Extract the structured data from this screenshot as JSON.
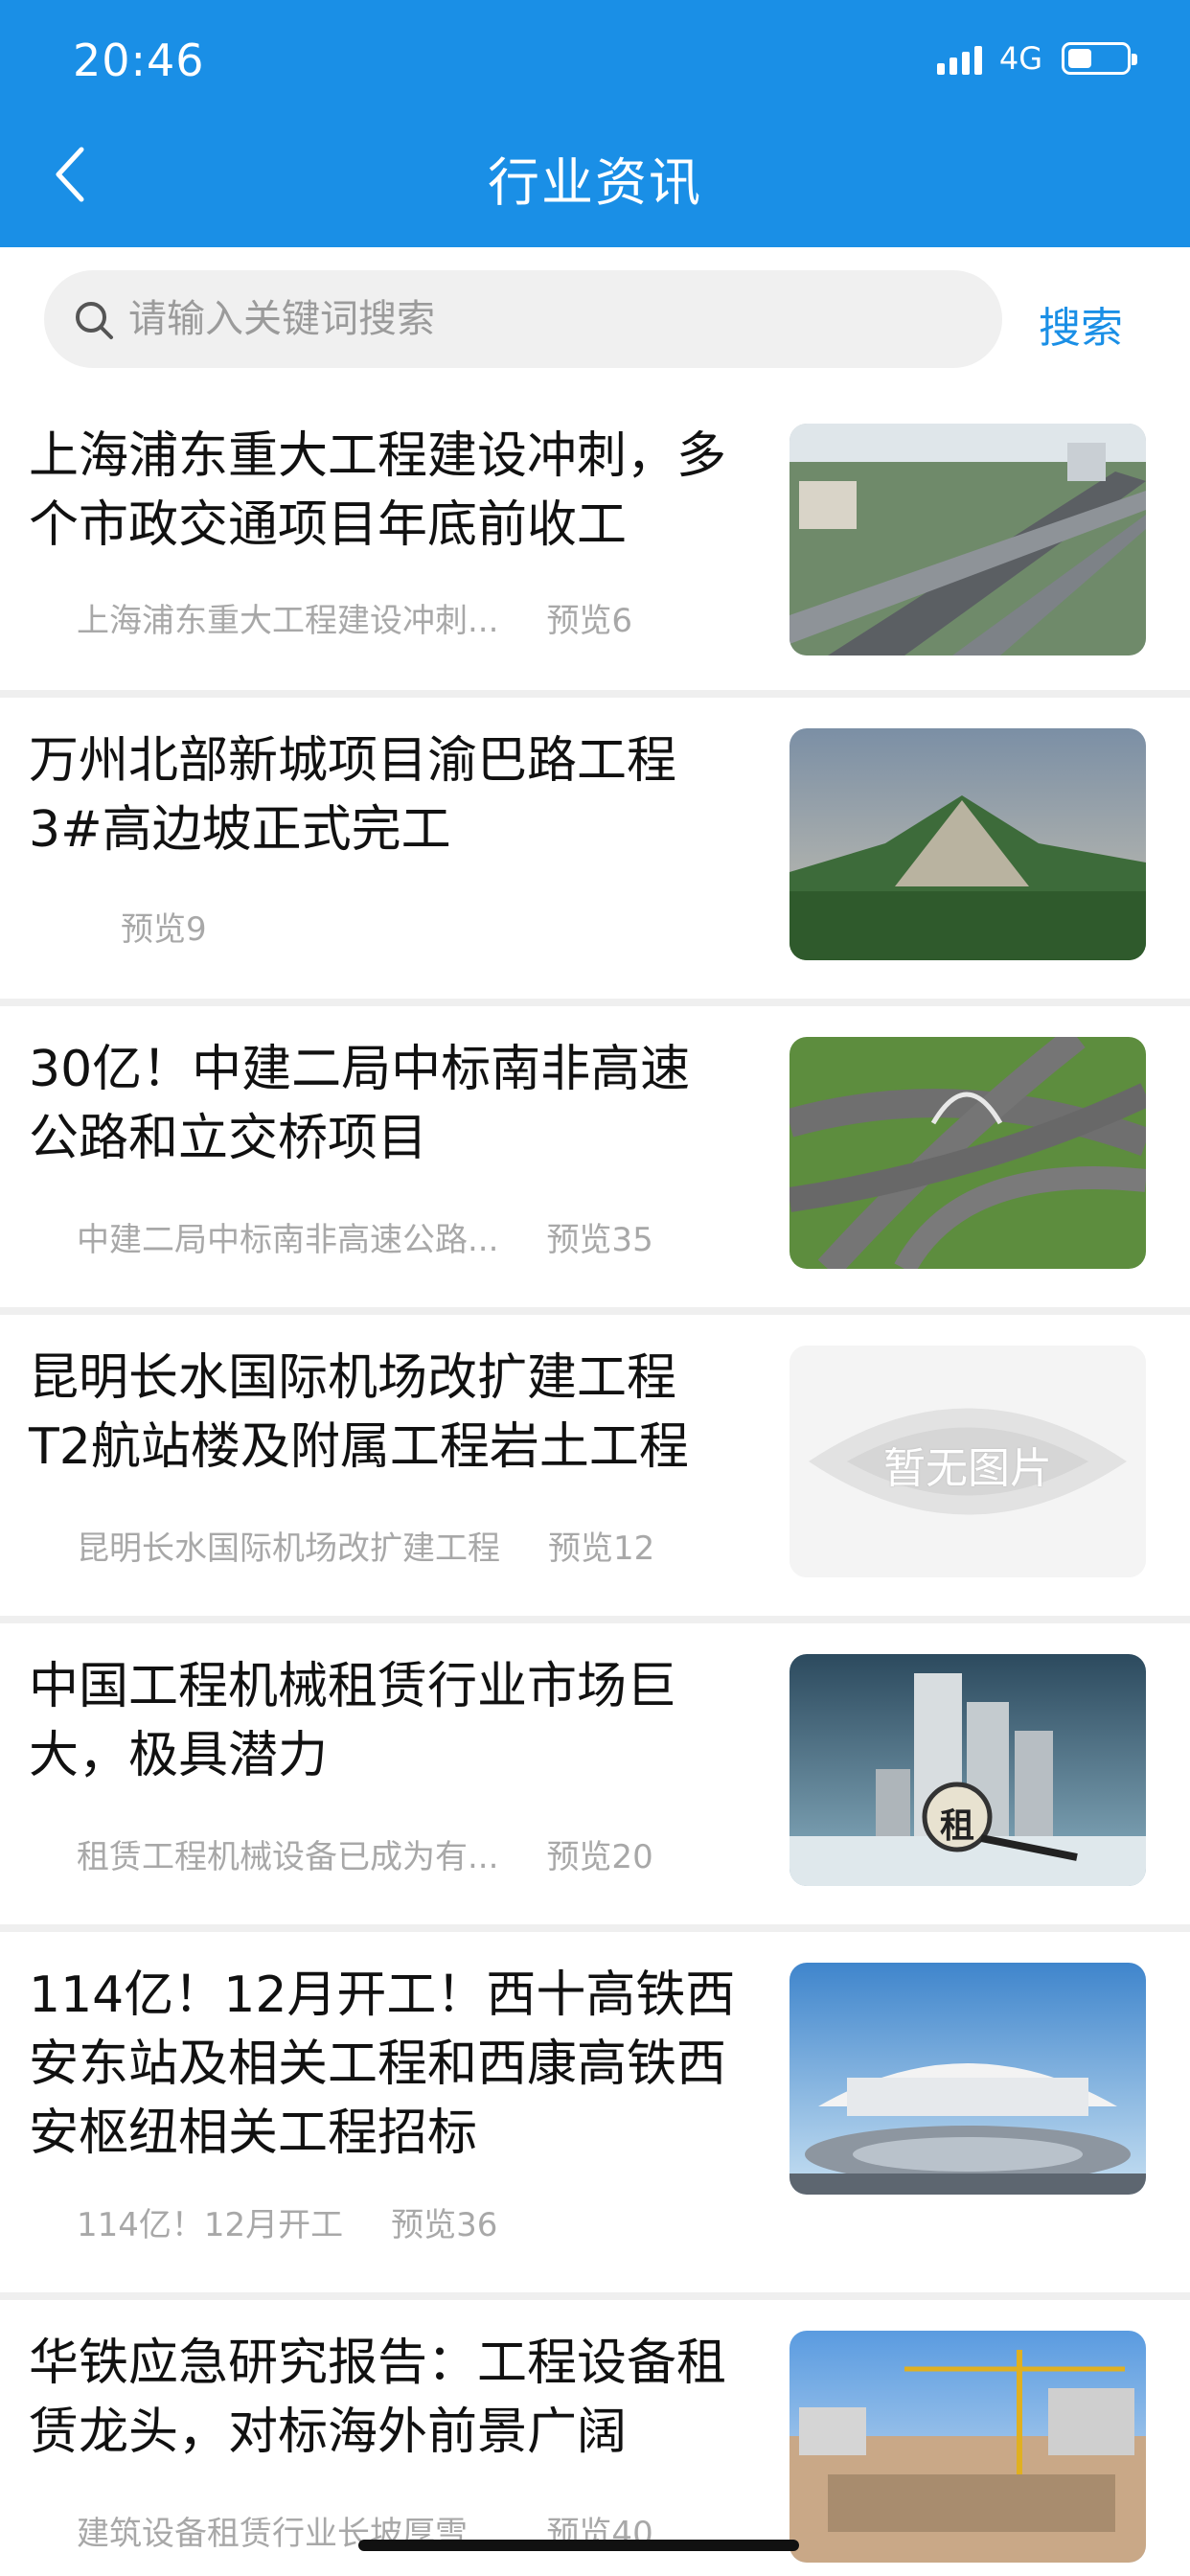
{
  "status_bar": {
    "time": "20:46",
    "network": "4G"
  },
  "header": {
    "title": "行业资讯",
    "back_icon": "chevron-left-icon",
    "background": "#1a8fe6"
  },
  "search": {
    "placeholder": "请输入关键词搜索",
    "value": "",
    "button_label": "搜索"
  },
  "news": [
    {
      "title": "上海浦东重大工程建设冲刺，多个市政交通项目年底前收工",
      "summary": "上海浦东重大工程建设冲刺...",
      "views": "预览6",
      "thumb": "highway-interchange-photo"
    },
    {
      "title": "万州北部新城项目渝巴路工程3#高边坡正式完工",
      "summary": "",
      "views": "预览9",
      "thumb": "hillside-slope-photo"
    },
    {
      "title": "30亿！中建二局中标南非高速公路和立交桥项目",
      "summary": "中建二局中标南非高速公路...",
      "views": "预览35",
      "thumb": "overpass-rendering"
    },
    {
      "title": "昆明长水国际机场改扩建工程T2航站楼及附属工程岩土工程",
      "summary": "昆明长水国际机场改扩建工程",
      "views": "预览12",
      "thumb": "no-image-placeholder",
      "thumb_text": "暂无图片"
    },
    {
      "title": "中国工程机械租赁行业市场巨大，极具潜力",
      "summary": "租赁工程机械设备已成为有...",
      "views": "预览20",
      "thumb": "buildings-puzzle-photo",
      "thumb_text": "租"
    },
    {
      "title": "114亿！12月开工！西十高铁西安东站及相关工程和西康高铁西安枢纽相关工程招标",
      "summary": "114亿！12月开工",
      "views": "预览36",
      "thumb": "railway-station-rendering"
    },
    {
      "title": "华铁应急研究报告：工程设备租赁龙头，对标海外前景广阔",
      "summary": "建筑设备租赁行业长坡厚雪...",
      "views": "预览40",
      "thumb": "construction-site-photo"
    }
  ]
}
